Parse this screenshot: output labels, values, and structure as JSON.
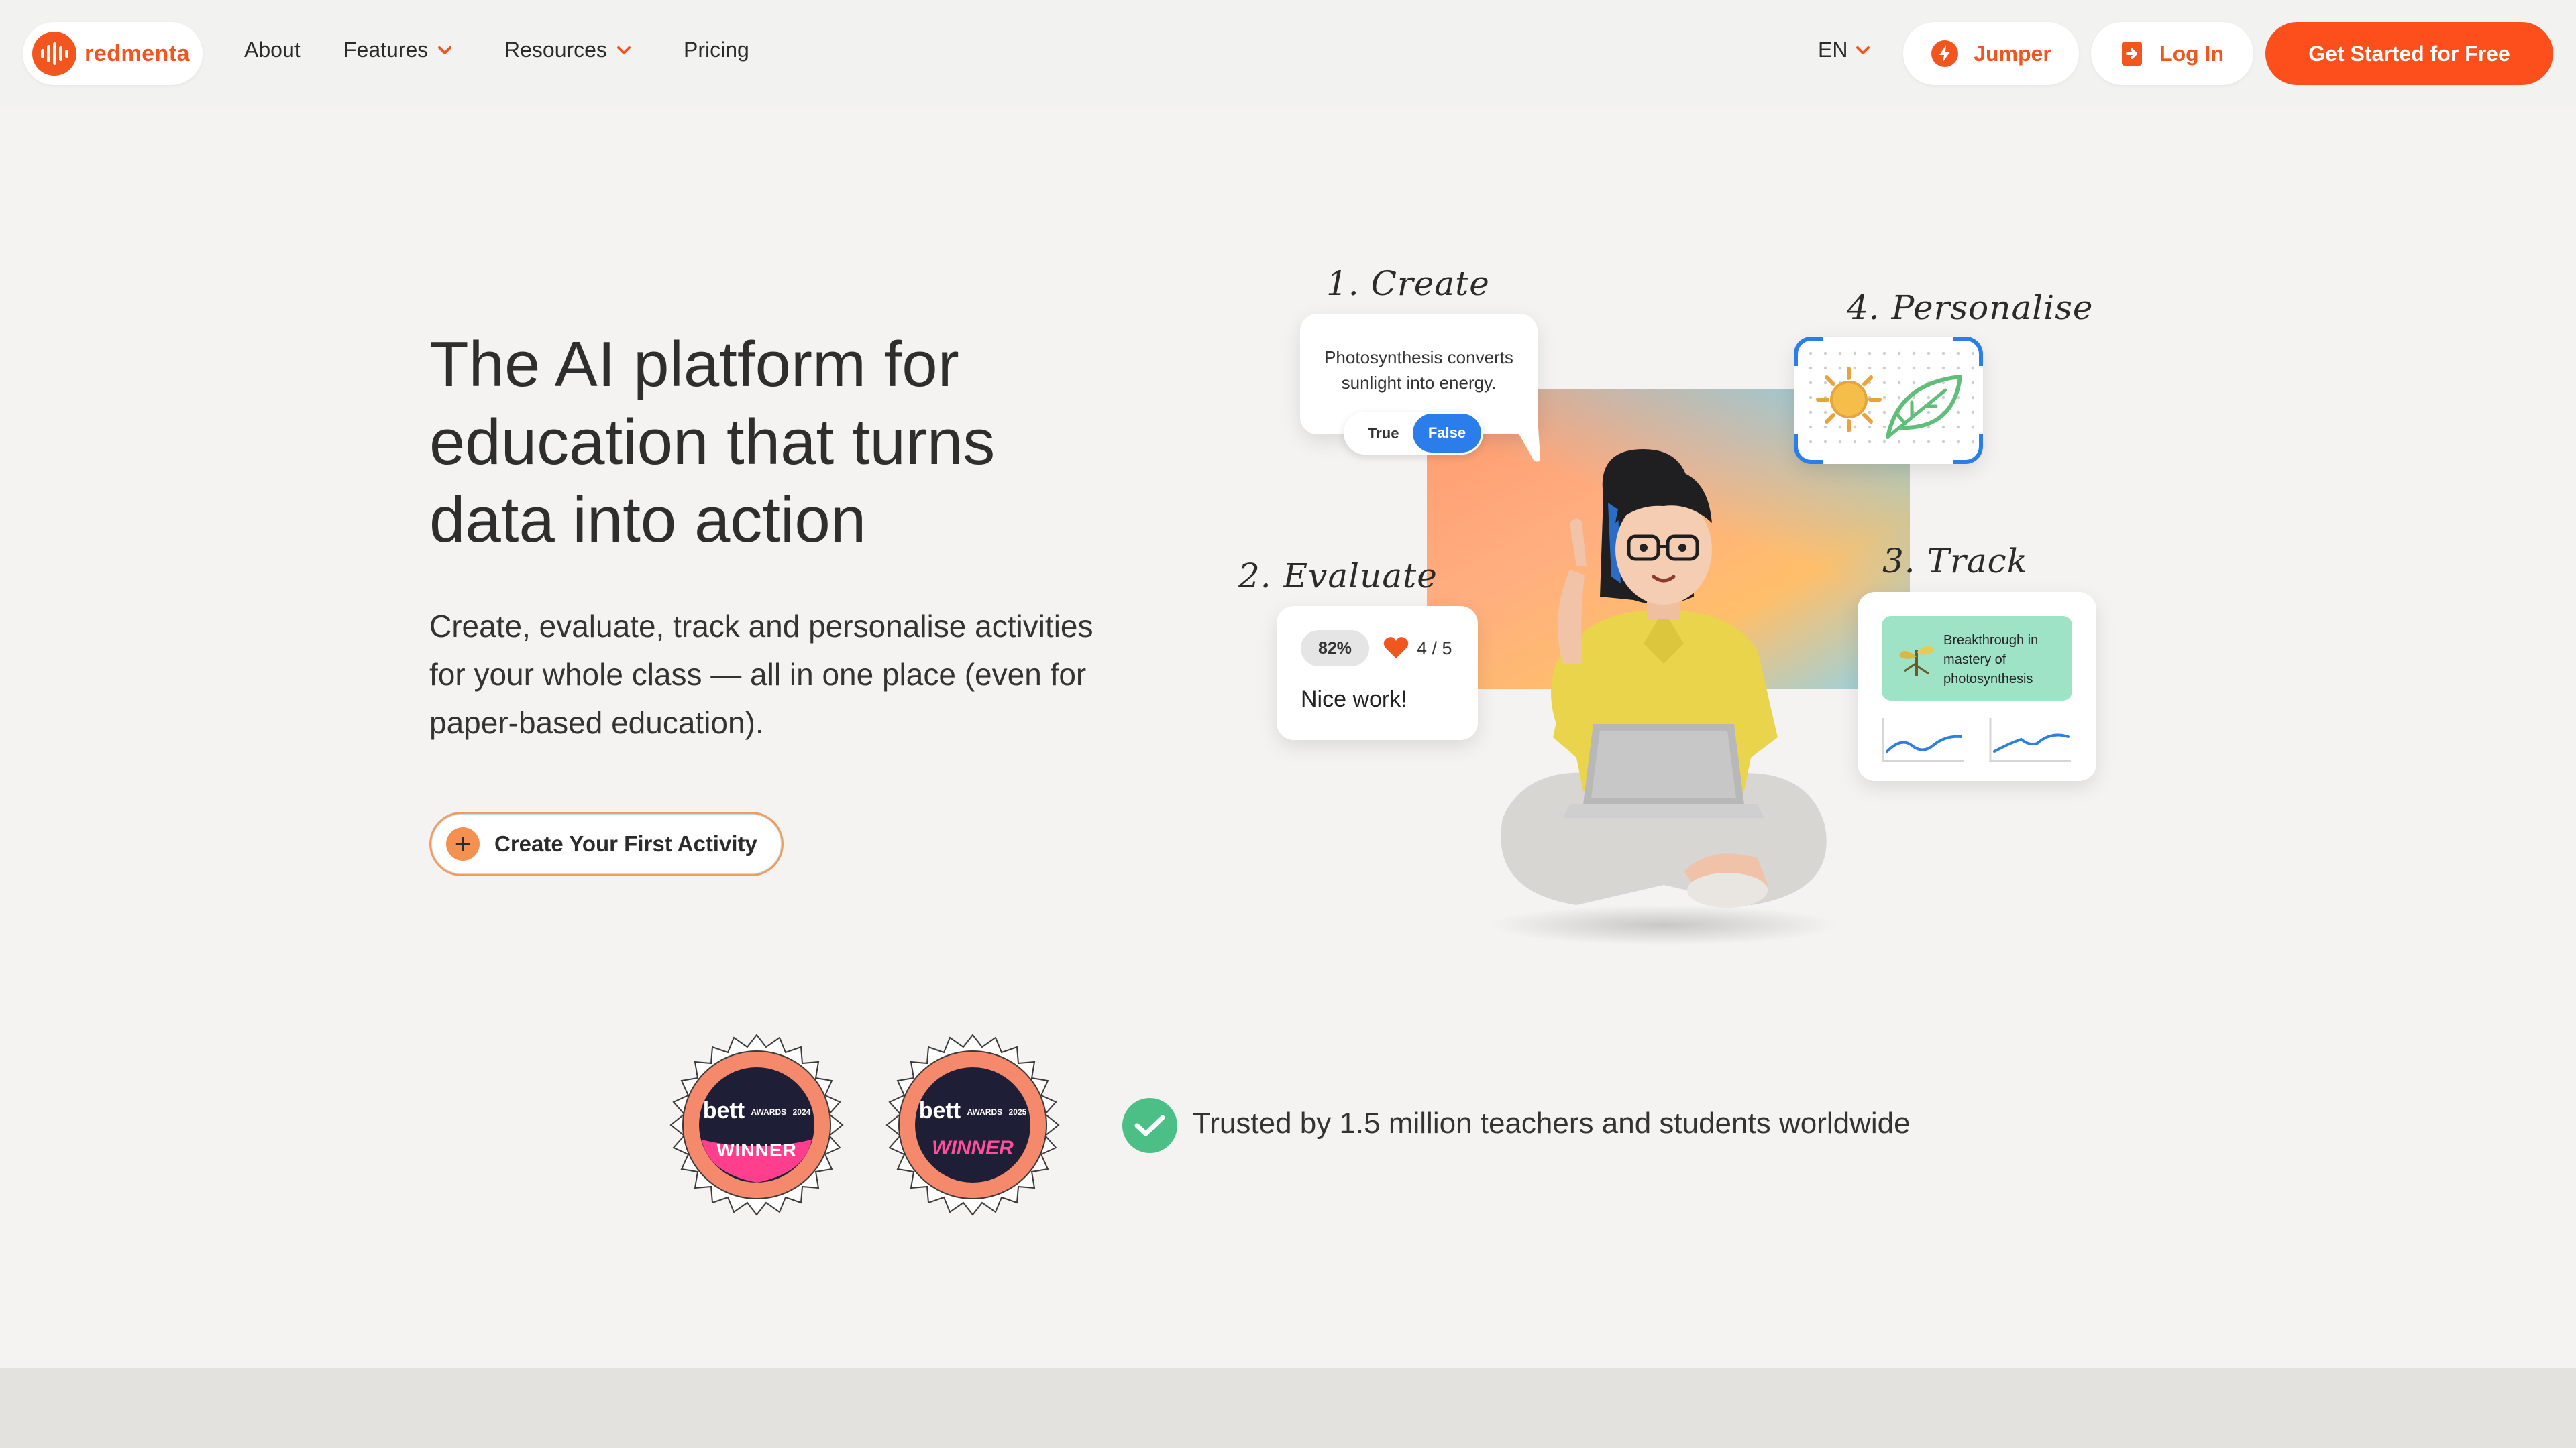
{
  "brand": {
    "name": "redmenta",
    "accent": "#f2551e",
    "primary_button_color": "#fc4f1c",
    "blue": "#2b7de9"
  },
  "nav": {
    "links": [
      {
        "label": "About",
        "has_dropdown": false
      },
      {
        "label": "Features",
        "has_dropdown": true
      },
      {
        "label": "Resources",
        "has_dropdown": true
      },
      {
        "label": "Pricing",
        "has_dropdown": false
      }
    ],
    "language": "EN",
    "jumper_label": "Jumper",
    "login_label": "Log In",
    "cta_label": "Get Started for Free"
  },
  "hero": {
    "title": "The AI platform for education that turns data into action",
    "subtitle": "Create, evaluate, track and personalise activities for your whole class — all in one place (even for paper-based education).",
    "cta_label": "Create Your First Activity"
  },
  "illustration": {
    "steps": {
      "create": "1. Create",
      "evaluate": "2. Evaluate",
      "track": "3. Track",
      "personalise": "4. Personalise"
    },
    "create_card": {
      "statement": "Photosynthesis converts sunlight into energy.",
      "option_true": "True",
      "option_false": "False",
      "selected": "False"
    },
    "evaluate_card": {
      "percent": "82%",
      "score": "4 / 5",
      "feedback": "Nice work!"
    },
    "track_card": {
      "banner": "Breakthrough in mastery of photosynthesis"
    },
    "personalise_card": {
      "icons": [
        "sun-icon",
        "leaf-icon"
      ]
    }
  },
  "awards": [
    {
      "brand": "bett",
      "label": "AWARDS",
      "year": "2024",
      "result": "WINNER"
    },
    {
      "brand": "bett",
      "label": "AWARDS",
      "year": "2025",
      "result": "WINNER"
    }
  ],
  "trust": {
    "text": "Trusted by 1.5 million teachers and students worldwide"
  }
}
